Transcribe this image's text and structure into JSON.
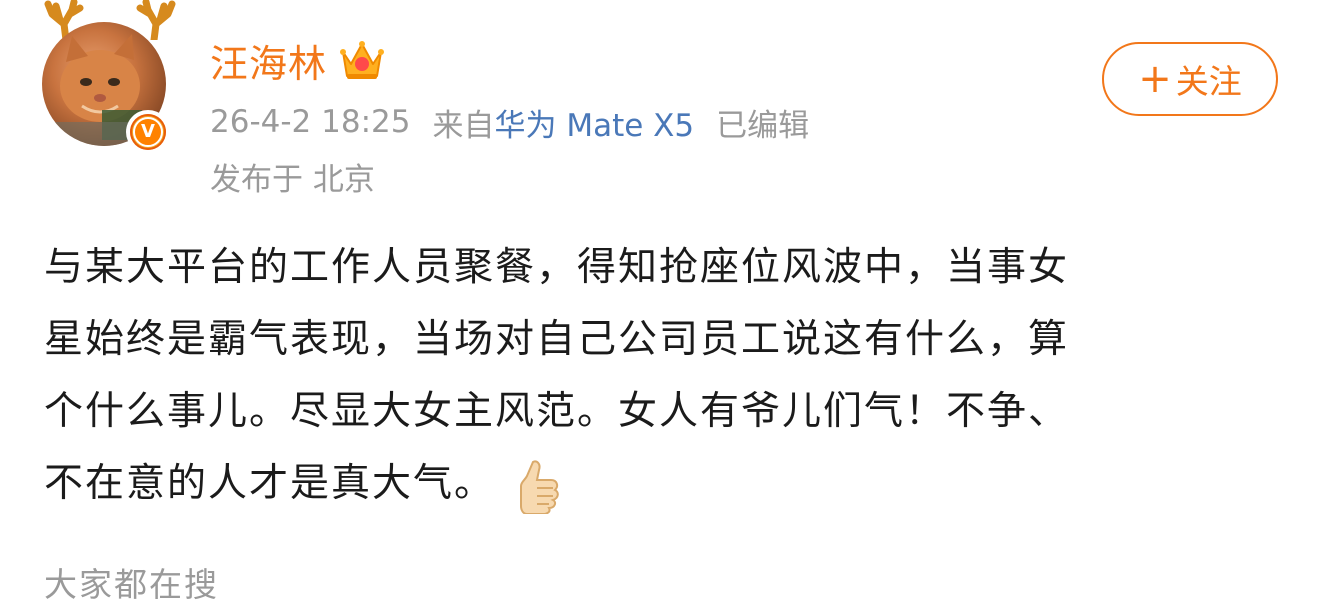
{
  "author": {
    "name": "汪海林",
    "verified_badge_glyph": "V",
    "vip_icon": "crown-icon",
    "avatar_icon": "cat-with-antlers-avatar",
    "name_color": "#f2771a"
  },
  "meta": {
    "timestamp": "26-4-2 18:25",
    "source_prefix": "来自",
    "source_device": "华为 Mate X5",
    "edited_label": "已编辑",
    "location_label": "发布于 北京",
    "source_link_color": "#4a78b8"
  },
  "follow": {
    "plus": "+",
    "label": "关注",
    "accent_color": "#f2771a"
  },
  "post": {
    "lines": [
      "与某大平台的工作人员聚餐，得知抢座位风波中，当事女",
      "星始终是霸气表现，当场对自己公司员工说这有什么，算",
      "个什么事儿。尽显大女主风范。女人有爷儿们气！不争、",
      "不在意的人才是真大气。"
    ],
    "trailing_emoji": "thumbs-up-icon"
  },
  "trending": {
    "label": "大家都在搜"
  }
}
